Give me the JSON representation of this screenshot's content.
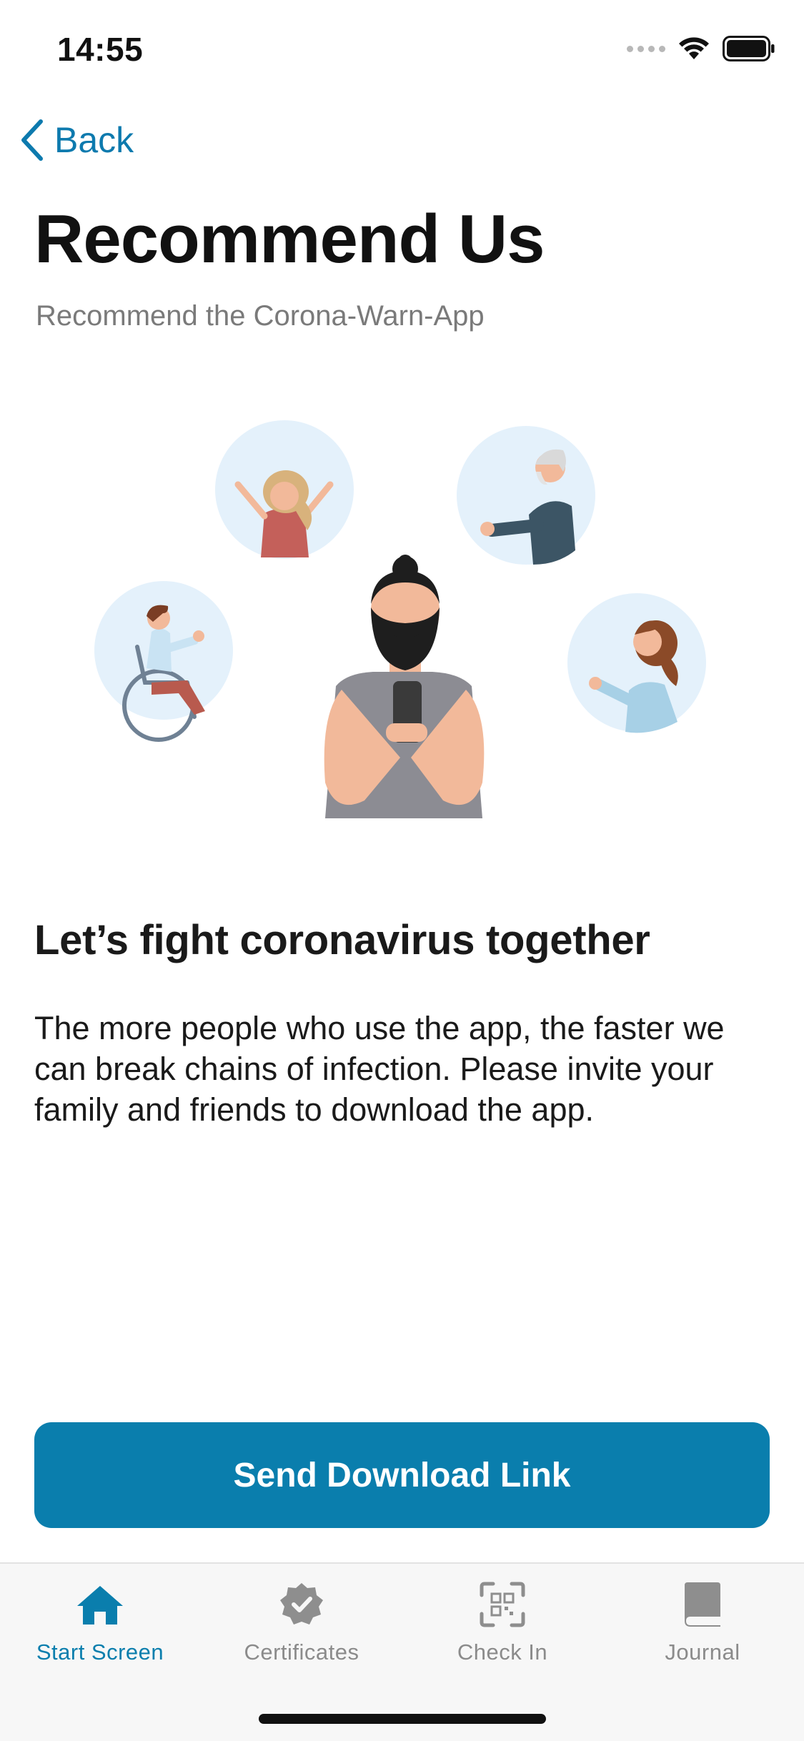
{
  "status_bar": {
    "time": "14:55"
  },
  "nav": {
    "back_label": "Back"
  },
  "header": {
    "title": "Recommend Us",
    "subtitle": "Recommend the Corona-Warn-App"
  },
  "content": {
    "heading": "Let’s fight coronavirus together",
    "body": "The more people who use the app, the faster we can break chains of infection. Please invite your family and friends to download the app."
  },
  "actions": {
    "primary_label": "Send Download Link"
  },
  "tab_bar": {
    "items": [
      {
        "label": "Start Screen",
        "icon": "home-icon",
        "active": true
      },
      {
        "label": "Certificates",
        "icon": "certificate-badge-icon",
        "active": false
      },
      {
        "label": "Check In",
        "icon": "qr-scan-icon",
        "active": false
      },
      {
        "label": "Journal",
        "icon": "book-icon",
        "active": false
      }
    ]
  },
  "colors": {
    "accent": "#0a7ead",
    "inactive_tab": "#8b8b8b",
    "subtitle": "#7a7a7a",
    "tab_bar_bg": "#f7f7f7"
  }
}
